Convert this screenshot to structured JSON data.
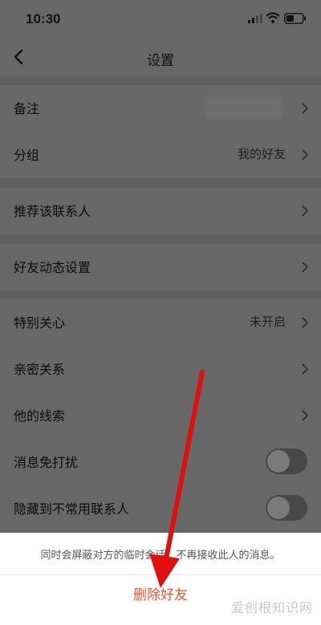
{
  "status_bar": {
    "time": "10:30"
  },
  "nav": {
    "title": "设置"
  },
  "groups": [
    {
      "rows": [
        {
          "label": "备注",
          "value": ""
        },
        {
          "label": "分组",
          "value": "我的好友"
        }
      ]
    },
    {
      "rows": [
        {
          "label": "推荐该联系人"
        }
      ]
    },
    {
      "rows": [
        {
          "label": "好友动态设置"
        }
      ]
    },
    {
      "rows": [
        {
          "label": "特别关心",
          "value": "未开启"
        },
        {
          "label": "亲密关系"
        },
        {
          "label": "他的线索"
        },
        {
          "label": "消息免打扰",
          "toggle_on": false
        },
        {
          "label": "隐藏到不常用联系人",
          "toggle_on": false
        }
      ]
    }
  ],
  "sheet": {
    "message": "同时会屏蔽对方的临时会话，不再接收此人的消息。",
    "delete_label": "删除好友"
  },
  "watermark": "爱创根知识网",
  "colors": {
    "accent_red": "#e8542f",
    "arrow_red": "#e01010"
  }
}
